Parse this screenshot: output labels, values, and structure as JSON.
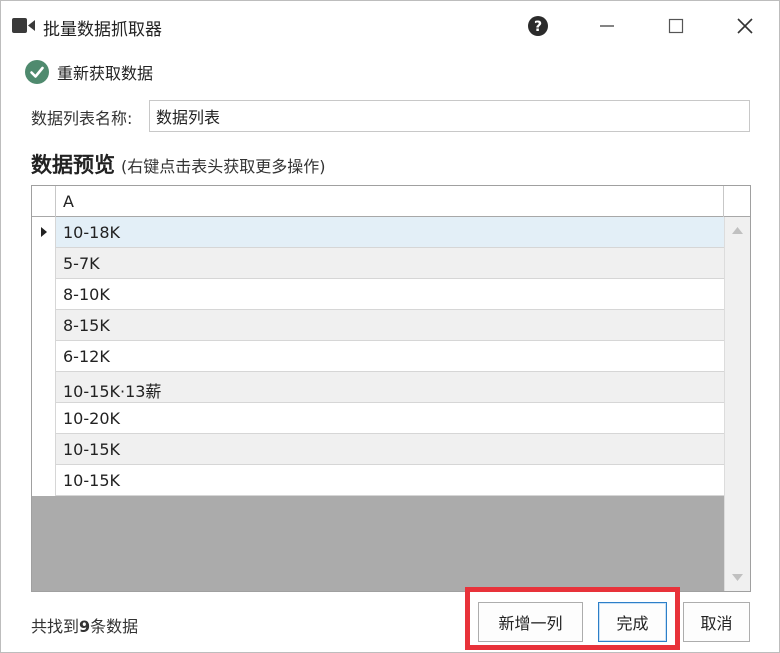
{
  "window": {
    "title": "批量数据抓取器",
    "icon": "camera-icon",
    "controls": [
      "help-icon",
      "minimize-icon",
      "maximize-icon",
      "close-icon"
    ]
  },
  "refresh": {
    "label": "重新获取数据",
    "icon": "check-circle-icon",
    "icon_color": "#4f8a6e"
  },
  "name_field": {
    "label": "数据列表名称:",
    "value": "数据列表"
  },
  "preview": {
    "title": "数据预览",
    "hint": "(右键点击表头获取更多操作)"
  },
  "grid": {
    "columns": [
      "A"
    ],
    "rows": [
      "10-18K",
      "5-7K",
      "8-10K",
      "8-15K",
      "6-12K",
      "10-15K·13薪",
      "10-20K",
      "10-15K",
      "10-15K"
    ],
    "selected_row": 0
  },
  "footer": {
    "count_prefix": "共找到",
    "count": "9",
    "count_suffix": "条数据",
    "add_column": "新增一列",
    "done": "完成",
    "cancel": "取消"
  },
  "colors": {
    "highlight": "#e8323a",
    "selected_row": "#e3eff7",
    "primary_border": "#2d7fc8"
  }
}
